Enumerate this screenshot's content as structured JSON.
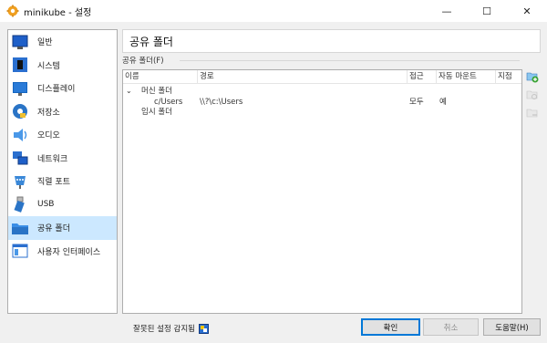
{
  "window": {
    "title": "minikube - 설정",
    "minimize": "—",
    "maximize": "☐",
    "close": "✕"
  },
  "sidebar": {
    "items": [
      {
        "label": "일반",
        "icon": "general-icon"
      },
      {
        "label": "시스템",
        "icon": "system-icon"
      },
      {
        "label": "디스플레이",
        "icon": "display-icon"
      },
      {
        "label": "저장소",
        "icon": "storage-icon"
      },
      {
        "label": "오디오",
        "icon": "audio-icon"
      },
      {
        "label": "네트워크",
        "icon": "network-icon"
      },
      {
        "label": "직렬 포트",
        "icon": "serial-port-icon"
      },
      {
        "label": "USB",
        "icon": "usb-icon"
      },
      {
        "label": "공유 폴더",
        "icon": "shared-folder-icon",
        "selected": true
      },
      {
        "label": "사용자 인터페이스",
        "icon": "user-interface-icon"
      }
    ]
  },
  "page": {
    "title": "공유 폴더",
    "group_label": "공유 폴더(F)"
  },
  "table": {
    "columns": [
      "이름",
      "경로",
      "접근",
      "자동 마운트",
      "지점"
    ],
    "rows": [
      {
        "name": "머신 폴더",
        "expander": "⌄",
        "path": "",
        "access": "",
        "automount": "",
        "point": ""
      },
      {
        "name": "c/Users",
        "path": "\\\\?\\c:\\Users",
        "access": "모두",
        "automount": "예",
        "point": ""
      },
      {
        "name": "임시 폴더",
        "path": "",
        "access": "",
        "automount": "",
        "point": ""
      }
    ]
  },
  "status": {
    "text": "잘못된 설정 감지됨"
  },
  "buttons": {
    "ok": "확인",
    "cancel": "취소",
    "help": "도움말(H)"
  },
  "colors": {
    "selected_bg": "#cce8ff",
    "default_button_border": "#0078d7",
    "add_green": "#3aa335"
  }
}
